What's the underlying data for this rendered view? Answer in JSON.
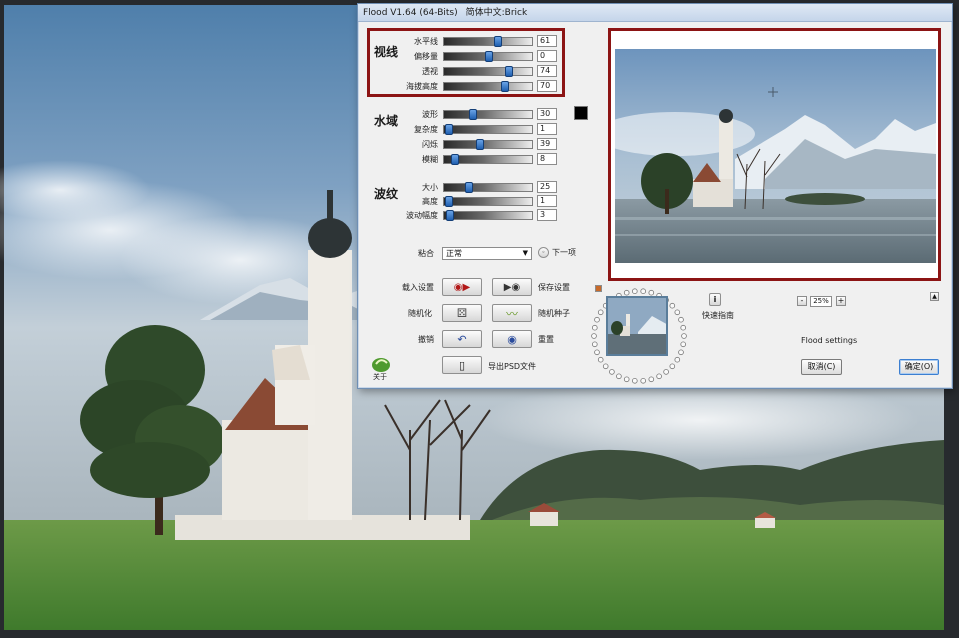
{
  "window": {
    "title": "Flood V1.64 (64-Bits)",
    "subtitle": "简体中文:Brick"
  },
  "groups": {
    "horizon": {
      "label": "视线",
      "params": [
        {
          "label": "水平线",
          "value": "61",
          "level": 0.61
        },
        {
          "label": "偏移量",
          "value": "0",
          "level": 0.5
        },
        {
          "label": "透视",
          "value": "74",
          "level": 0.74
        },
        {
          "label": "海拔高度",
          "value": "70",
          "level": 0.7
        }
      ]
    },
    "water": {
      "label": "水域",
      "params": [
        {
          "label": "波形",
          "value": "30",
          "level": 0.3
        },
        {
          "label": "复杂度",
          "value": "1",
          "level": 0.01
        },
        {
          "label": "闪烁",
          "value": "39",
          "level": 0.39
        },
        {
          "label": "模糊",
          "value": "8",
          "level": 0.08
        }
      ]
    },
    "ripple": {
      "label": "波纹",
      "params": [
        {
          "label": "大小",
          "value": "25",
          "level": 0.25
        },
        {
          "label": "高度",
          "value": "1",
          "level": 0.01
        },
        {
          "label": "波动幅度",
          "value": "3",
          "level": 0.03
        }
      ]
    }
  },
  "blend": {
    "label": "粘合",
    "value": "正常",
    "next_label": "下一项"
  },
  "buttons": {
    "load_settings": "载入设置",
    "save_settings": "保存设置",
    "randomize": "随机化",
    "random_seed": "随机种子",
    "undo": "撤销",
    "reset": "重置",
    "about": "关于",
    "export_psd": "导出PSD文件",
    "quick_guide": "快速指南",
    "cancel": "取消(C)",
    "ok": "确定(O)"
  },
  "zoom": {
    "value": "25%",
    "minus": "-",
    "plus": "+"
  },
  "status": "Flood settings",
  "colors": {
    "red_highlight": "#8c1414",
    "water_color": "#000000"
  }
}
